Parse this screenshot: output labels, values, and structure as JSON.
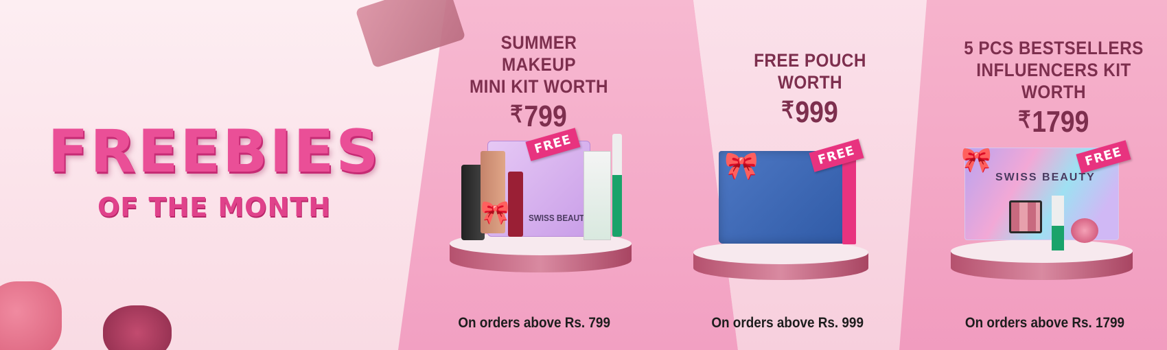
{
  "headline": {
    "title": "FREEBIES",
    "subtitle": "OF THE MONTH"
  },
  "offers": [
    {
      "title_line1": "SUMMER MAKEUP",
      "title_line2": "MINI KIT WORTH",
      "rupee": "₹",
      "price": "799",
      "free_label": "FREE",
      "pouch_brand": "SWISS BEAUTY",
      "note": "On orders above Rs. 799"
    },
    {
      "title_line1": "FREE POUCH WORTH",
      "rupee": "₹",
      "price": "999",
      "free_label": "FREE",
      "note": "On orders above Rs. 999"
    },
    {
      "title_line1": "5 PCS BESTSELLERS",
      "title_line2": "INFLUENCERS KIT WORTH",
      "rupee": "₹",
      "price": "1799",
      "free_label": "FREE",
      "pouch_brand": "SWISS BEAUTY",
      "note": "On orders above Rs. 1799"
    }
  ],
  "colors": {
    "accent": "#e8337f",
    "title_pink": "#ea4f97",
    "price_text": "#7d2f4e",
    "panel_pink": "#f2a3c3"
  }
}
